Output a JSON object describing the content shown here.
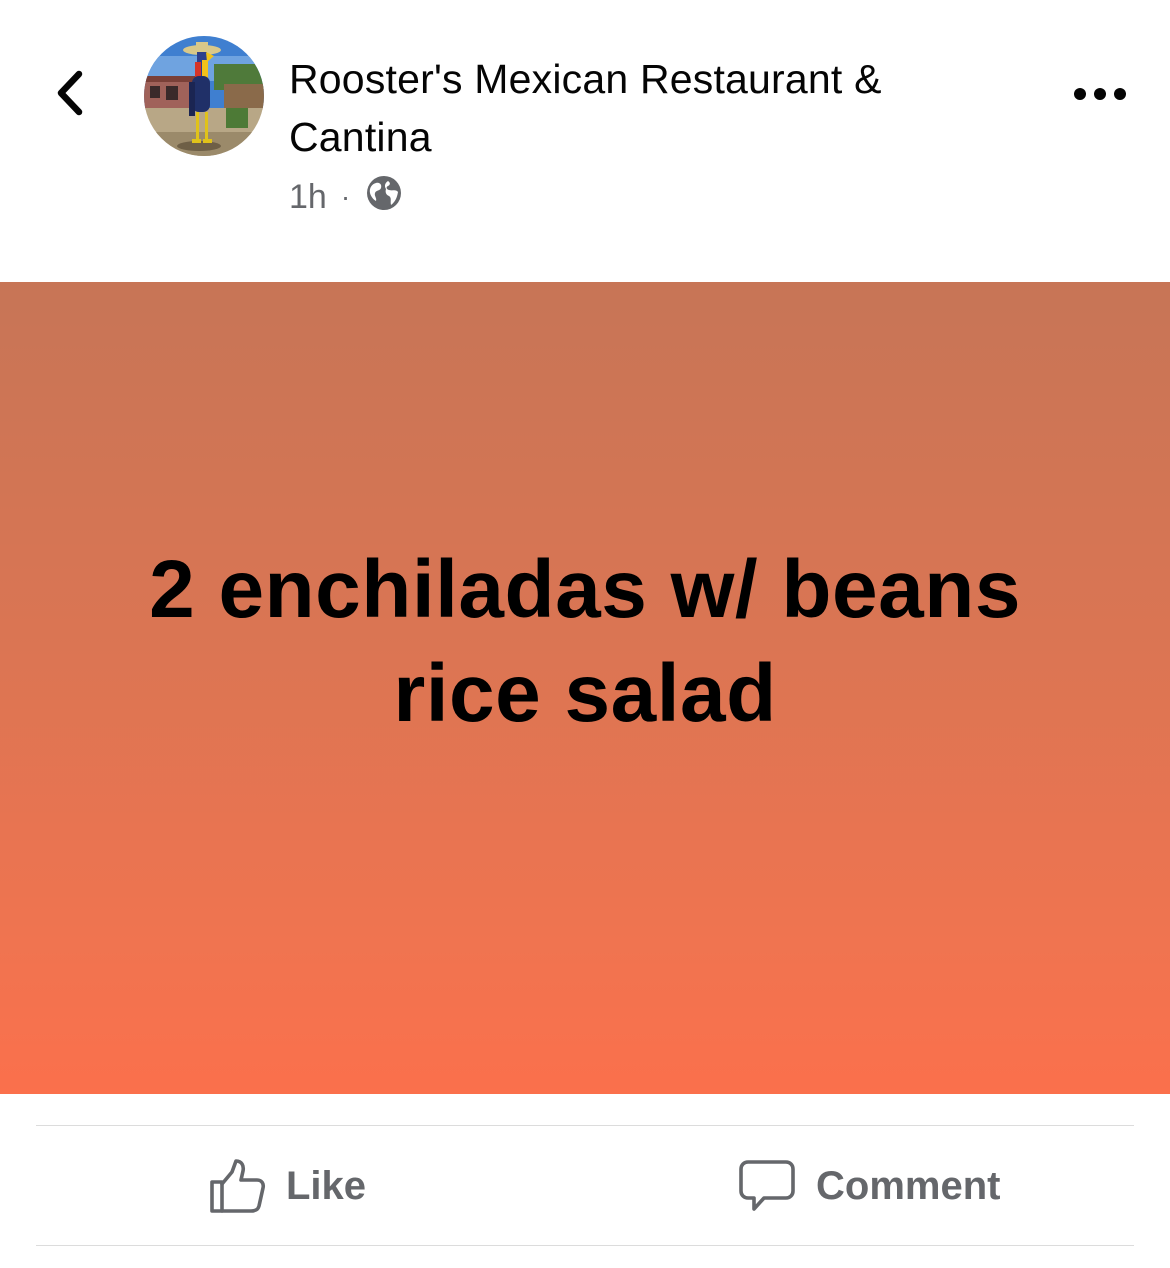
{
  "header": {
    "back_icon": "chevron-left-icon",
    "page_name": "Rooster's Mexican Restaurant & Cantina",
    "timestamp": "1h",
    "separator": "·",
    "privacy_icon": "globe-icon",
    "more_icon": "more-horizontal-icon"
  },
  "post": {
    "text": "2 enchiladas w/ beans\nrice salad",
    "background_top": "#c77556",
    "background_bottom": "#fb704c",
    "text_color": "#000000"
  },
  "actions": {
    "like_label": "Like",
    "like_icon": "thumbs-up-icon",
    "comment_label": "Comment",
    "comment_icon": "speech-bubble-icon"
  },
  "colors": {
    "primary_text": "#050505",
    "secondary_text": "#65676b",
    "divider": "#dcdcdc"
  }
}
